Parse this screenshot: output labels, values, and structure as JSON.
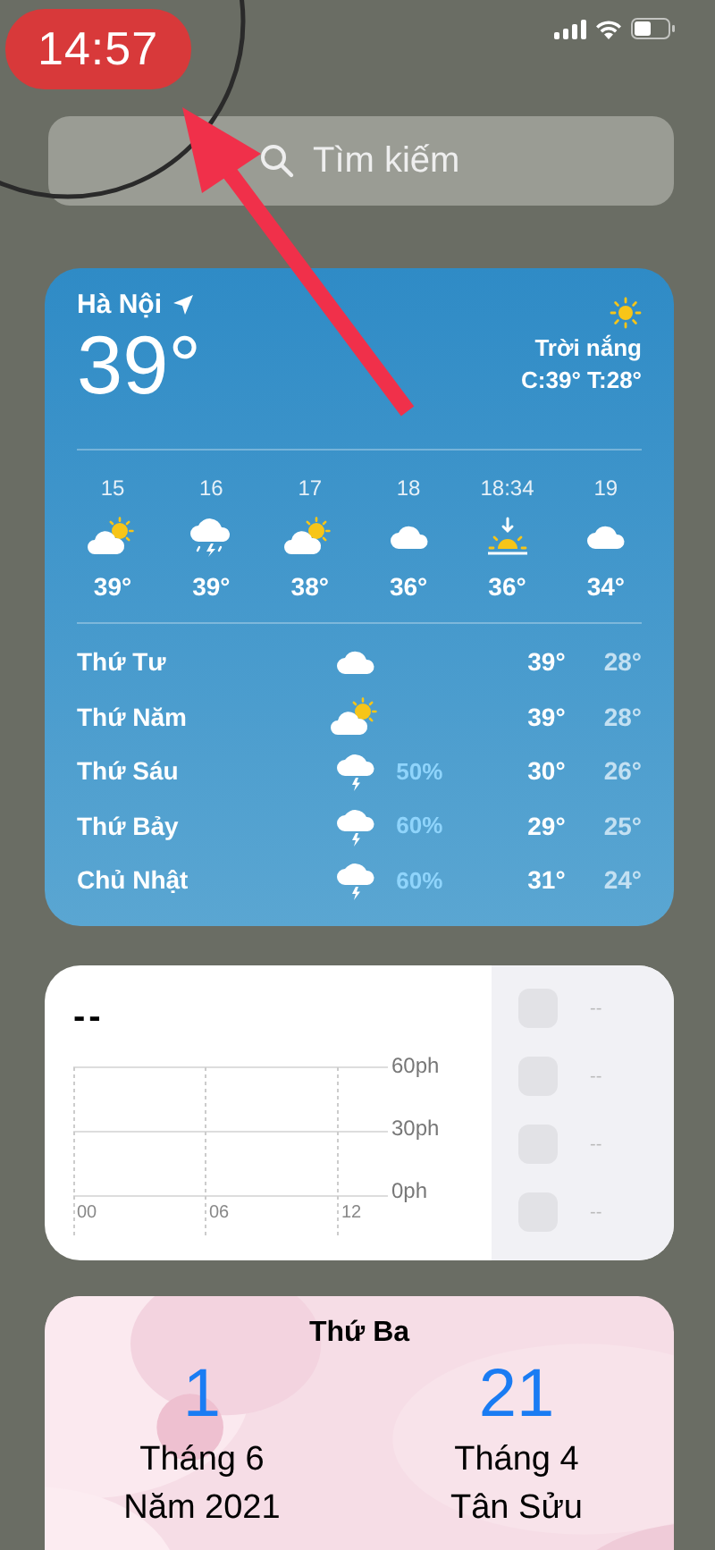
{
  "status_bar": {
    "time": "14:57"
  },
  "search": {
    "placeholder": "Tìm kiếm"
  },
  "weather": {
    "city": "Hà Nội",
    "temperature": "39°",
    "condition": "Trời nắng",
    "range": "C:39° T:28°",
    "hourly": [
      {
        "time": "15",
        "kind": "sun-cloud",
        "temp": "39°"
      },
      {
        "time": "16",
        "kind": "storm",
        "temp": "39°"
      },
      {
        "time": "17",
        "kind": "sun-cloud",
        "temp": "38°"
      },
      {
        "time": "18",
        "kind": "cloud",
        "temp": "36°"
      },
      {
        "time": "18:34",
        "kind": "sunset",
        "temp": "36°"
      },
      {
        "time": "19",
        "kind": "cloud",
        "temp": "34°"
      }
    ],
    "daily": [
      {
        "day": "Thứ Tư",
        "kind": "cloud",
        "high": "39°",
        "low": "28°"
      },
      {
        "day": "Thứ Năm",
        "kind": "sun-cloud",
        "high": "39°",
        "low": "28°"
      },
      {
        "day": "Thứ Sáu",
        "kind": "storm",
        "precip": "50%",
        "high": "30°",
        "low": "26°"
      },
      {
        "day": "Thứ Bảy",
        "kind": "storm",
        "precip": "60%",
        "high": "29°",
        "low": "25°"
      },
      {
        "day": "Chủ Nhật",
        "kind": "storm",
        "precip": "60%",
        "high": "31°",
        "low": "24°"
      }
    ]
  },
  "screen_time": {
    "total": "--",
    "y_labels": [
      "60ph",
      "30ph",
      "0ph"
    ],
    "x_labels": [
      "00",
      "06",
      "12"
    ],
    "apps": [
      {
        "value": "--"
      },
      {
        "value": "--"
      },
      {
        "value": "--"
      },
      {
        "value": "--"
      }
    ]
  },
  "calendar": {
    "weekday": "Thứ Ba",
    "solar": {
      "day": "1",
      "month": "Tháng 6",
      "year": "Năm 2021"
    },
    "lunar": {
      "day": "21",
      "month": "Tháng 4",
      "year": "Tân Sửu"
    }
  }
}
